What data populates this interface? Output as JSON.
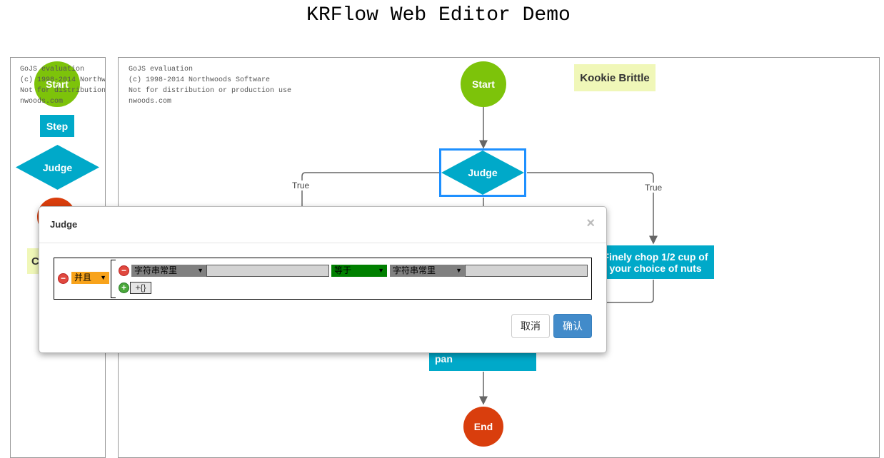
{
  "page": {
    "title": "KRFlow Web Editor Demo"
  },
  "watermark": {
    "palette_lines": "GoJS evaluation\n(c) 1998-2014 Northw\nNot for distribution\nnwoods.com",
    "canvas_lines": "GoJS evaluation\n(c) 1998-2014 Northwoods Software\nNot for distribution or production use\nnwoods.com"
  },
  "palette": {
    "start": "Start",
    "step": "Step",
    "judge": "Judge",
    "comment_partial": "C"
  },
  "diagram": {
    "start": "Start",
    "judge": "Judge",
    "comment": "Kookie Brittle",
    "edge_left_label": "True",
    "edge_right_label": "True",
    "step_right": "Finely chop 1/2 cup of your choice of nuts",
    "step_bottom": "pan",
    "end": "End"
  },
  "colors": {
    "start_green": "#7dc30a",
    "node_blue": "#00a9c9",
    "end_red": "#d93e0d",
    "selection_blue": "#1e90ff",
    "comment_yellow": "#f0f7b8",
    "logic_orange": "#f8a31b",
    "operator_green": "#008000",
    "primary_button": "#428bca"
  },
  "modal": {
    "title": "Judge",
    "close_icon": "close-icon",
    "logic_select": "并且",
    "condition": {
      "left_type": "字符串常里",
      "left_value": "",
      "operator": "等于",
      "right_type": "字符串常里",
      "right_value": ""
    },
    "add_label": "+{}",
    "cancel_label": "取消",
    "confirm_label": "确认"
  }
}
